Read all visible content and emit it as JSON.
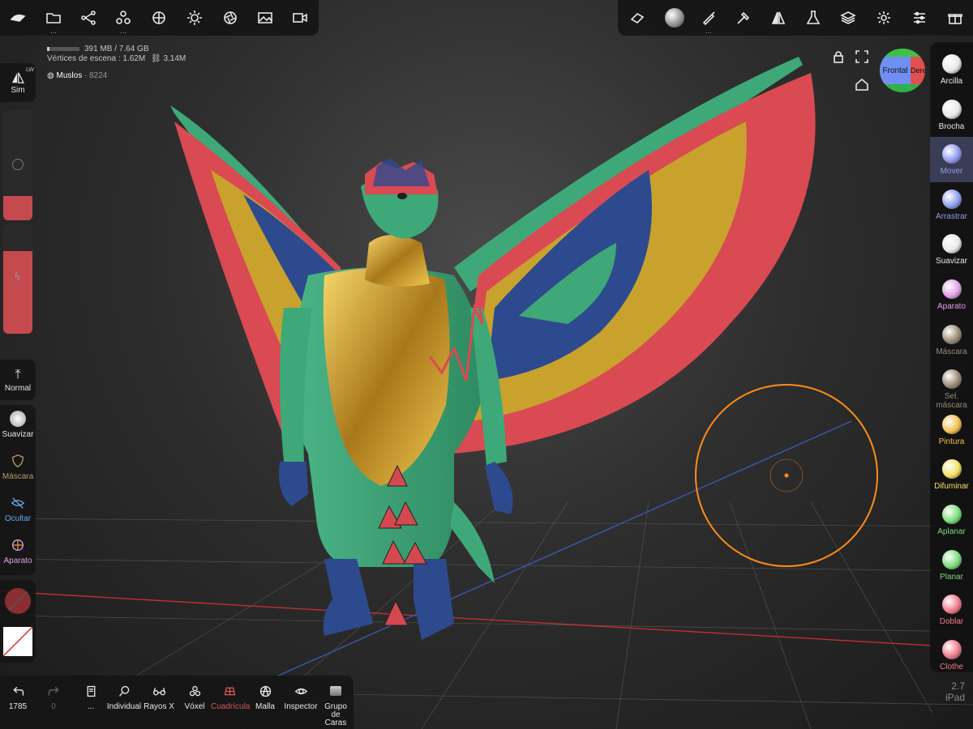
{
  "stats": {
    "memory": "391 MB / 7.64 GB",
    "vertices_label": "Vértices de escena : 1.62M",
    "faces": "3.14M",
    "object_name": "Muslos",
    "object_count": "8224"
  },
  "top_left_icons": [
    "hand-icon",
    "folder-icon",
    "scene-graph-icon",
    "topology-icon",
    "material-sphere-icon",
    "light-icon",
    "aperture-icon",
    "image-icon",
    "video-camera-icon"
  ],
  "top_right_icons": [
    "eraser-icon",
    "matcap-icon",
    "brush-icon",
    "hammer-icon",
    "symmetry-icon",
    "flask-icon",
    "layers-icon",
    "gear-icon",
    "sliders-icon",
    "gift-icon"
  ],
  "left_panel": {
    "sim_label": "Sim",
    "sim_badge": "LW",
    "normal_label": "Normal",
    "tools": [
      "Suavizar",
      "Máscara",
      "Ocultar",
      "Aparato"
    ],
    "colors": {
      "suavizar": "#e8e8e8",
      "mascara": "#b89a6a",
      "ocultar": "#6aa8e8",
      "aparato": "#e0a0e8"
    }
  },
  "right_tools": [
    {
      "label": "Arcilla",
      "color": "#e8e8e8",
      "active": false
    },
    {
      "label": "Brocha",
      "color": "#e8e8e8",
      "active": false
    },
    {
      "label": "Mover",
      "color": "#8f9cf0",
      "active": true
    },
    {
      "label": "Arrastrar",
      "color": "#8f9cf0",
      "active": false
    },
    {
      "label": "Suavizar",
      "color": "#e8e8e8",
      "active": false
    },
    {
      "label": "Aparato",
      "color": "#e0a0e8",
      "active": false
    },
    {
      "label": "Máscara",
      "color": "#9a8a74",
      "active": false
    },
    {
      "label": "Sel. máscara",
      "color": "#9a8a74",
      "active": false
    },
    {
      "label": "Pintura",
      "color": "#f4c050",
      "active": false
    },
    {
      "label": "Difuminar",
      "color": "#f4e060",
      "active": false
    },
    {
      "label": "Aplanar",
      "color": "#7cdc7c",
      "active": false
    },
    {
      "label": "Planar",
      "color": "#7cdc7c",
      "active": false
    },
    {
      "label": "Doblar",
      "color": "#f07a8a",
      "active": false
    },
    {
      "label": "Clothe",
      "color": "#f07a8a",
      "active": false
    }
  ],
  "bottom_bar": {
    "undo_count": "1785",
    "redo_count": "0",
    "more_label": "...",
    "tools": [
      "Individual",
      "Rayos X",
      "Vóxel",
      "Cuadrícula",
      "Malla",
      "Inspector",
      "Grupo de\nCaras"
    ],
    "active_tool": "Cuadrícula"
  },
  "gizmo": {
    "front_label": "Frontal",
    "right_label": "Dere"
  },
  "version": {
    "number": "2.7",
    "device": "iPad"
  },
  "colors": {
    "accent": "#8f9cf0",
    "brush_circle": "#ff8c1a",
    "dragon_green": "#3fa878",
    "gold": "#d8a82a",
    "wing_red": "#d94a52",
    "wing_blue": "#2e4a8e",
    "paint_color": "#d4494f"
  }
}
